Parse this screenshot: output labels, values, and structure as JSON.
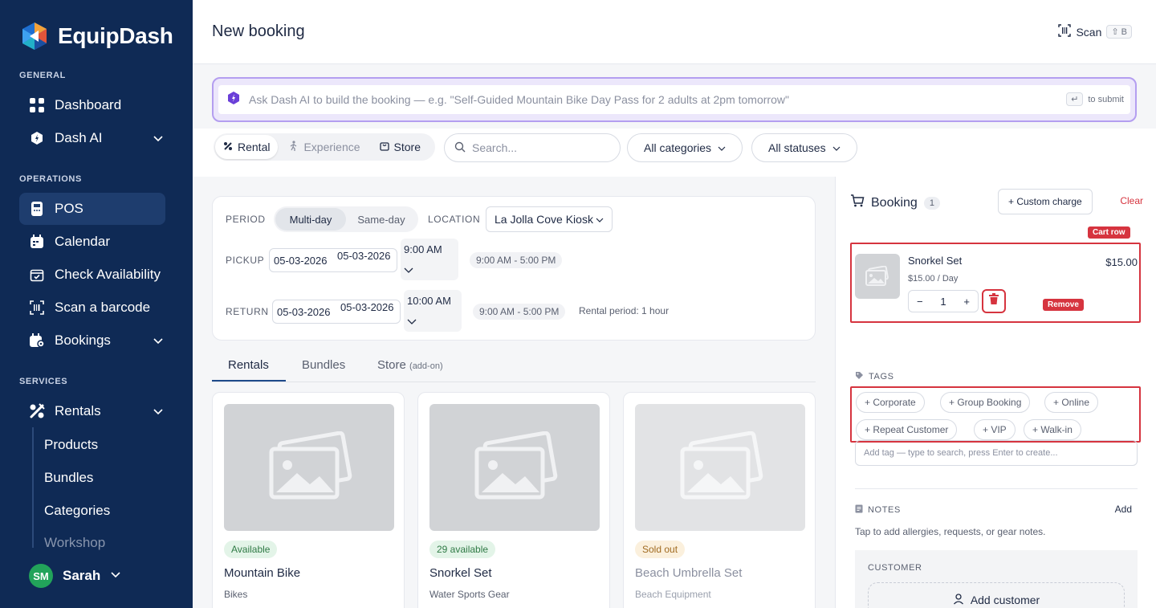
{
  "brand": {
    "name": "EquipDash"
  },
  "sidebar": {
    "sections": {
      "general": "GENERAL",
      "operations": "OPERATIONS",
      "services": "SERVICES"
    },
    "items": {
      "dashboard": "Dashboard",
      "dash_ai": "Dash AI",
      "pos": "POS",
      "calendar": "Calendar",
      "check_availability": "Check Availability",
      "scan_barcode": "Scan a barcode",
      "bookings": "Bookings",
      "rentals": "Rentals"
    },
    "sub_items": [
      "Products",
      "Bundles",
      "Categories",
      "Workshop"
    ],
    "user": {
      "initials": "SM",
      "name": "Sarah"
    }
  },
  "header": {
    "title": "New booking",
    "scan_label": "Scan",
    "scan_shortcut": "⇧ B"
  },
  "ai": {
    "placeholder": "Ask Dash AI to build the booking — e.g. \"Self-Guided Mountain Bike Day Pass for 2 adults at 2pm tomorrow\"",
    "enter_key": "↵",
    "hint": "to submit"
  },
  "filters": {
    "modes": [
      "Rental",
      "Experience",
      "Store"
    ],
    "search_placeholder": "Search...",
    "categories": "All categories",
    "statuses": "All statuses"
  },
  "period": {
    "label": "PERIOD",
    "multi_day": "Multi-day",
    "same_day": "Same-day",
    "location_label": "LOCATION",
    "location_value": "La Jolla Cove Kiosk",
    "pickup_label": "PICKUP",
    "pickup_date_1": "05-03-2026",
    "pickup_date_2": "05-03-2026",
    "pickup_time": "9:00 AM",
    "pickup_hours": "9:00 AM - 5:00 PM",
    "return_label": "RETURN",
    "return_date_1": "05-03-2026",
    "return_date_2": "05-03-2026",
    "return_time": "10:00 AM",
    "return_hours": "9:00 AM - 5:00 PM",
    "rental_period": "Rental period: 1 hour"
  },
  "tabs": {
    "rentals": "Rentals",
    "bundles": "Bundles",
    "store": "Store",
    "store_note": "(add-on)"
  },
  "products": [
    {
      "status": "Available",
      "name": "Mountain Bike",
      "category": "Bikes"
    },
    {
      "status": "29 available",
      "name": "Snorkel Set",
      "category": "Water Sports Gear"
    },
    {
      "status": "Sold out",
      "name": "Beach Umbrella Set",
      "category": "Beach Equipment"
    }
  ],
  "booking": {
    "title": "Booking",
    "count": "1",
    "custom_charge": "+ Custom charge",
    "clear": "Clear",
    "cart_row_tag": "Cart row",
    "remove_tag": "Remove",
    "item": {
      "name": "Snorkel Set",
      "price": "$15.00",
      "rate": "$15.00 / Day",
      "qty": "1",
      "minus": "−",
      "plus": "+"
    },
    "tags_label": "TAGS",
    "tags": [
      "+ Corporate",
      "+ Group Booking",
      "+ Online",
      "+ Repeat Customer",
      "+ VIP",
      "+ Walk-in"
    ],
    "tag_input_placeholder": "Add tag — type to search, press Enter to create...",
    "notes_label": "NOTES",
    "notes_add": "Add",
    "notes_hint": "Tap to add allergies, requests, or gear notes.",
    "customer_label": "CUSTOMER",
    "add_customer": "Add customer"
  },
  "colors": {
    "sidebar": "#0f2a55",
    "accent_red": "#d6343f",
    "ai_border": "#b49ef0",
    "success": "#22a35a"
  }
}
